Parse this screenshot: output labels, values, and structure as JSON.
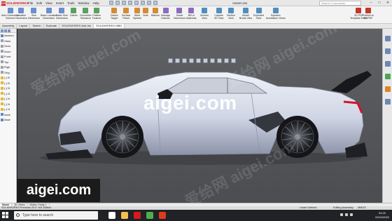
{
  "titlebar": {
    "brand": "SOLIDWORKS",
    "brand_mark": "DS",
    "menus": [
      "File",
      "Edit",
      "View",
      "Insert",
      "Tools",
      "Window",
      "Help"
    ],
    "document_title": "Assem.res",
    "search_placeholder": "Search Commands",
    "controls": [
      "–",
      "□",
      "✕"
    ]
  },
  "command_manager": {
    "items": [
      {
        "label": "Auto Dimension\nScheme",
        "color": "#6b8fcf"
      },
      {
        "label": "Location\nDimension",
        "color": "#6b8fcf"
      },
      {
        "label": "Size\nDimension",
        "color": "#6b8fcf"
      },
      {
        "label": "Basic Location\nDimension",
        "color": "#6b8fcf"
      },
      {
        "label": "Basic Size\nDimension",
        "color": "#6b8fcf"
      },
      {
        "label": "Datum",
        "color": "#5aa05e"
      },
      {
        "label": "Geometric\nTolerance",
        "color": "#5aa05e"
      },
      {
        "label": "Pattern\nFeature",
        "color": "#5aa05e"
      },
      {
        "label": "Datum\nTarget",
        "color": "#d68a33"
      },
      {
        "label": "Surface\nFinish",
        "color": "#d68a33"
      },
      {
        "label": "Weld\nSymbol",
        "color": "#d68a33"
      },
      {
        "label": "Note",
        "color": "#d68a33"
      },
      {
        "label": "Balloon",
        "color": "#d68a33"
      },
      {
        "label": "Manage\nDatums",
        "color": "#8d6bbf"
      },
      {
        "label": "Smart\nDimension",
        "color": "#8d6bbf"
      },
      {
        "label": "Bill of\nMaterials",
        "color": "#8d6bbf"
      },
      {
        "label": "Section\nView",
        "color": "#4e8fc0"
      },
      {
        "label": "Capture\n3D View",
        "color": "#4e8fc0"
      },
      {
        "label": "Section\nView",
        "color": "#4e8fc0"
      },
      {
        "label": "Model\nBreak View",
        "color": "#4e8fc0"
      },
      {
        "label": "Exploded\nView",
        "color": "#4e8fc0"
      },
      {
        "label": "Dynamic\nAnnotation Views",
        "color": "#4e8fc0"
      },
      {
        "label": "3D PDF\nTemplate Editor",
        "color": "#c0392b"
      },
      {
        "label": "Publish to\n3D PDF",
        "color": "#c0392b"
      }
    ],
    "tabs": [
      "Assembly",
      "Layout",
      "Sketch",
      "Evaluate",
      "SOLIDWORKS Add-Ins",
      "SOLIDWORKS MBD"
    ],
    "active_tab": "SOLIDWORKS MBD"
  },
  "feature_tree": {
    "items": [
      {
        "label": "Assem.r",
        "icon": "assembly-icon",
        "kind": "blue"
      },
      {
        "label": "Histo",
        "icon": "history-icon",
        "kind": "grey"
      },
      {
        "label": "Sens",
        "icon": "sensor-icon",
        "kind": "grey"
      },
      {
        "label": "Anno",
        "icon": "annotation-icon",
        "kind": "grey"
      },
      {
        "label": "Front",
        "icon": "plane-icon",
        "kind": "grey"
      },
      {
        "label": "Top",
        "icon": "plane-icon",
        "kind": "grey"
      },
      {
        "label": "Righ",
        "icon": "plane-icon",
        "kind": "grey"
      },
      {
        "label": "Orig",
        "icon": "origin-icon",
        "kind": "grey"
      },
      {
        "label": "(-) B",
        "icon": "part-icon",
        "kind": "yellow"
      },
      {
        "label": "(-) N",
        "icon": "part-icon",
        "kind": "yellow"
      },
      {
        "label": "(-) N",
        "icon": "part-icon",
        "kind": "yellow"
      },
      {
        "label": "(-) N",
        "icon": "part-icon",
        "kind": "yellow"
      },
      {
        "label": "(-) N",
        "icon": "part-icon",
        "kind": "yellow"
      },
      {
        "label": "(-) N",
        "icon": "part-icon",
        "kind": "yellow"
      },
      {
        "label": "(-) N",
        "icon": "part-icon",
        "kind": "yellow"
      },
      {
        "label": "Asse",
        "icon": "assembly-icon",
        "kind": "blue"
      },
      {
        "label": "Asse",
        "icon": "assembly-icon",
        "kind": "blue"
      }
    ]
  },
  "watermark": {
    "main": "aigei.com",
    "box": "aigei.com",
    "faint": "爱给网 aigei.com"
  },
  "bottom_tabs": [
    "Model",
    "3D Views",
    "Motion Study 1"
  ],
  "active_bottom_tab": "Model",
  "status_bar": {
    "left": "SOLIDWORKS Premium 2017 x64 Edition",
    "state": "Under Defined",
    "mode": "Editing Assembly",
    "units": "MMGS"
  },
  "taskbar": {
    "search_placeholder": "Type here to search",
    "apps": [
      {
        "icon": "task-view-icon",
        "color": "#ffffff"
      },
      {
        "icon": "file-explorer-icon",
        "color": "#f2c14e"
      },
      {
        "icon": "solidworks-icon",
        "color": "#d71920"
      },
      {
        "icon": "chrome-icon",
        "color": "#4caf50"
      },
      {
        "icon": "adobe-icon",
        "color": "#e03a1e"
      }
    ],
    "time": "04:22",
    "date": "22/04/2022"
  },
  "colors": {
    "viewport_top": "#5f6165",
    "viewport_bottom": "#4b4d51",
    "car_body": "#dfe3ef",
    "car_shadow": "#9aa3ba",
    "tail_light": "#d4142a"
  }
}
